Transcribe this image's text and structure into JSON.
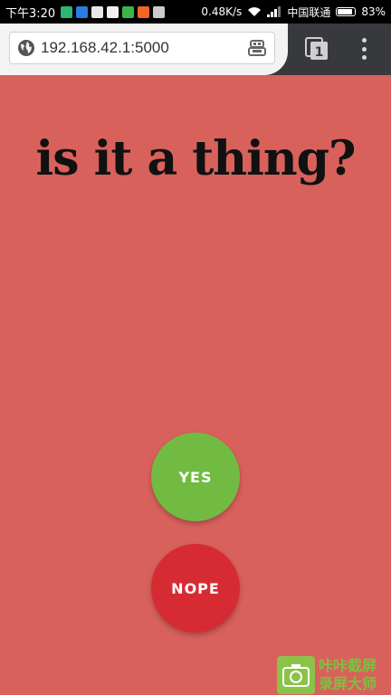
{
  "status_bar": {
    "time": "下午3:20",
    "network_speed": "0.48K/s",
    "carrier": "中国联通",
    "battery": "83%",
    "notification_icons": [
      {
        "name": "app-icon-teal",
        "color": "#2bb673"
      },
      {
        "name": "app-icon-blue",
        "color": "#2a7be4"
      },
      {
        "name": "app-icon-white",
        "color": "#e8e8e8"
      },
      {
        "name": "app-icon-qq",
        "color": "#f0f0f0"
      },
      {
        "name": "app-icon-green",
        "color": "#39b54a"
      },
      {
        "name": "app-icon-orange",
        "color": "#f26522"
      },
      {
        "name": "app-icon-gray",
        "color": "#cccccc"
      }
    ]
  },
  "browser": {
    "url": "192.168.42.1:5000",
    "tab_count": "1"
  },
  "page": {
    "title": "is it a thing?",
    "yes_label": "YES",
    "nope_label": "NOPE"
  },
  "watermark": {
    "line1": "咔咔截屏",
    "line2": "录屏大师"
  },
  "colors": {
    "background": "#d9615c",
    "yes": "#72bb43",
    "nope": "#d72b33"
  }
}
